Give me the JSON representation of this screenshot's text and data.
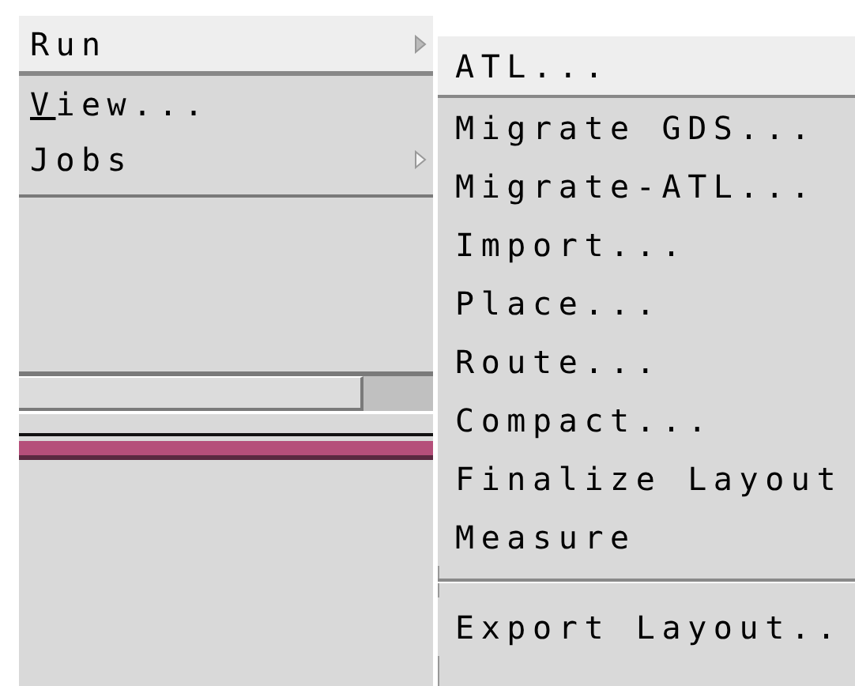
{
  "menu": {
    "items": [
      {
        "label": "Run",
        "selected": true,
        "submenu": true,
        "mnemonic_first": false,
        "disabled": false
      },
      {
        "label": "View...",
        "selected": false,
        "submenu": false,
        "mnemonic_first": true,
        "disabled": false
      },
      {
        "label": "Jobs",
        "selected": false,
        "submenu": true,
        "mnemonic_first": false,
        "disabled": false
      }
    ]
  },
  "submenu": {
    "items": [
      {
        "kind": "item",
        "label": "ATL...",
        "selected": true
      },
      {
        "kind": "item",
        "label": "Migrate GDS...",
        "selected": false
      },
      {
        "kind": "item",
        "label": "Migrate-ATL...",
        "selected": false
      },
      {
        "kind": "item",
        "label": "Import...",
        "selected": false
      },
      {
        "kind": "item",
        "label": "Place...",
        "selected": false
      },
      {
        "kind": "item",
        "label": "Route...",
        "selected": false
      },
      {
        "kind": "item",
        "label": "Compact...",
        "selected": false
      },
      {
        "kind": "item",
        "label": "Finalize Layout",
        "selected": false
      },
      {
        "kind": "item",
        "label": "Measure",
        "selected": false
      },
      {
        "kind": "separator"
      },
      {
        "kind": "item",
        "label": "Export Layout..",
        "selected": false
      }
    ]
  }
}
